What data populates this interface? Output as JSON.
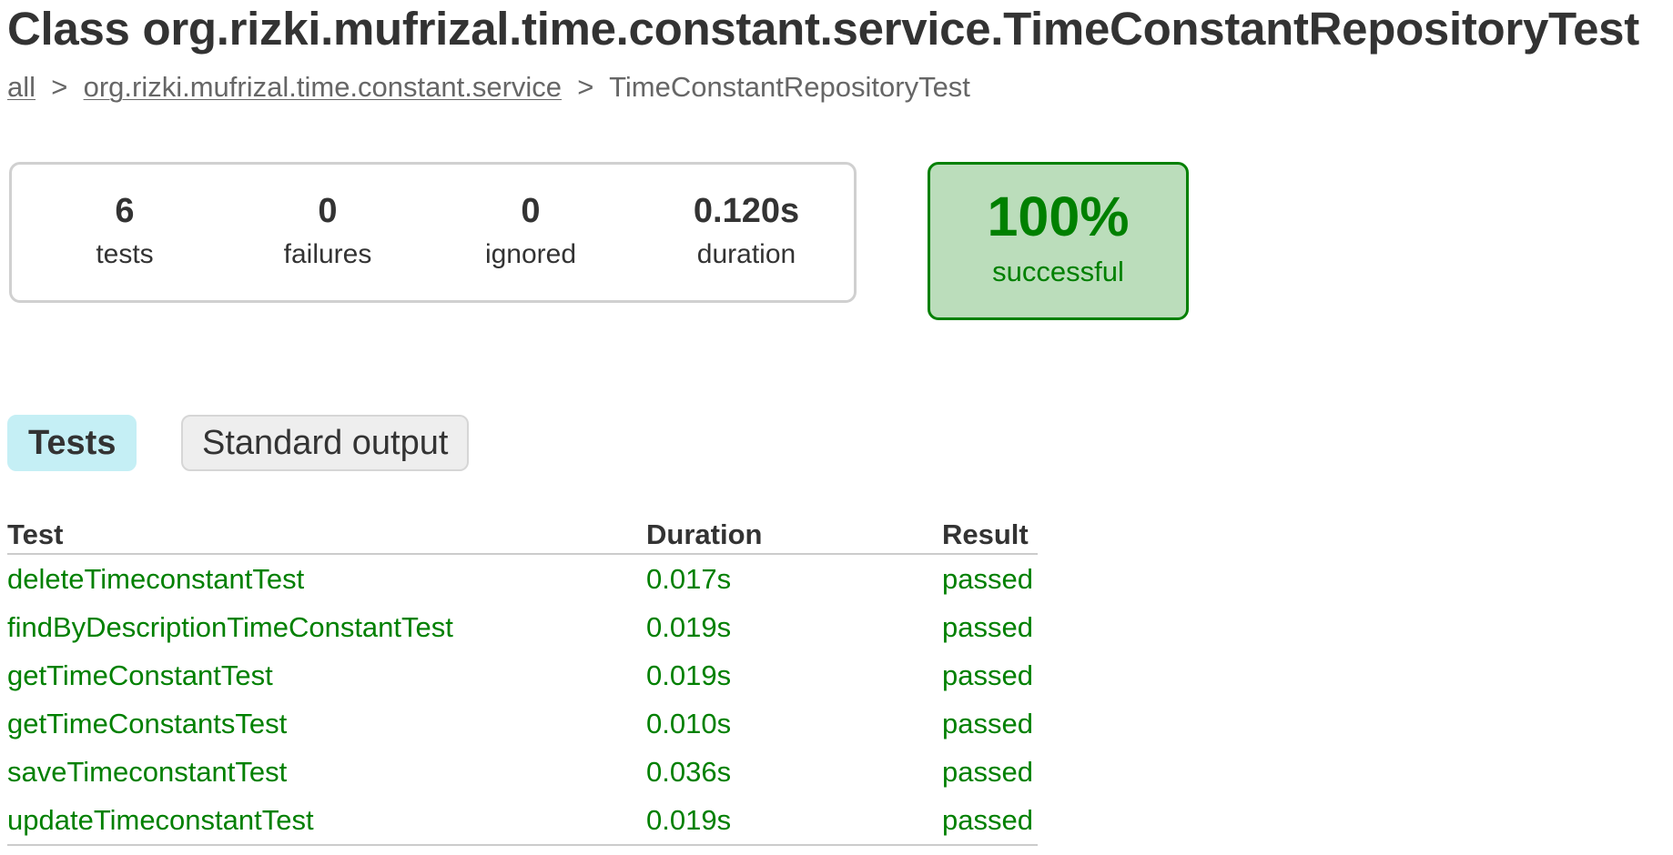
{
  "header": {
    "title": "Class org.rizki.mufrizal.time.constant.service.TimeConstantRepositoryTest"
  },
  "breadcrumbs": {
    "root_link": "all",
    "separator": ">",
    "package_link": "org.rizki.mufrizal.time.constant.service",
    "current": "TimeConstantRepositoryTest"
  },
  "summary": {
    "tests": {
      "value": "6",
      "label": "tests"
    },
    "failures": {
      "value": "0",
      "label": "failures"
    },
    "ignored": {
      "value": "0",
      "label": "ignored"
    },
    "duration": {
      "value": "0.120s",
      "label": "duration"
    }
  },
  "success_rate": {
    "value": "100%",
    "label": "successful",
    "color": "#008000",
    "background": "#bbddbb"
  },
  "tabs": [
    {
      "label": "Tests",
      "selected": true
    },
    {
      "label": "Standard output",
      "selected": false
    }
  ],
  "table": {
    "columns": [
      "Test",
      "Duration",
      "Result"
    ],
    "rows": [
      {
        "test": "deleteTimeconstantTest",
        "duration": "0.017s",
        "result": "passed"
      },
      {
        "test": "findByDescriptionTimeConstantTest",
        "duration": "0.019s",
        "result": "passed"
      },
      {
        "test": "getTimeConstantTest",
        "duration": "0.019s",
        "result": "passed"
      },
      {
        "test": "getTimeConstantsTest",
        "duration": "0.010s",
        "result": "passed"
      },
      {
        "test": "saveTimeconstantTest",
        "duration": "0.036s",
        "result": "passed"
      },
      {
        "test": "updateTimeconstantTest",
        "duration": "0.019s",
        "result": "passed"
      }
    ]
  },
  "colors": {
    "passed": "#008000",
    "tab_selected": "#c5eff5",
    "text": "#333333"
  }
}
